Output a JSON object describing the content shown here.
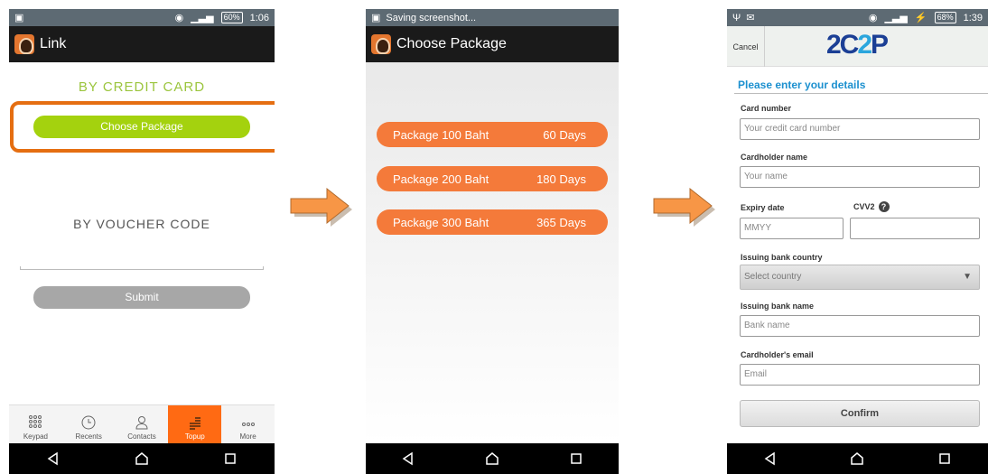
{
  "screen1": {
    "status_battery": "60%",
    "status_time": "1:06",
    "app_title": "Link",
    "credit_title": "BY CREDIT CARD",
    "choose_package": "Choose Package",
    "voucher_title": "BY VOUCHER CODE",
    "submit": "Submit",
    "tabs": [
      {
        "label": "Keypad",
        "icon": "keypad-icon"
      },
      {
        "label": "Recents",
        "icon": "clock-icon"
      },
      {
        "label": "Contacts",
        "icon": "contact-icon"
      },
      {
        "label": "Topup",
        "icon": "coins-icon"
      },
      {
        "label": "More",
        "icon": "more-icon"
      }
    ],
    "highlight_color": "#e56e11"
  },
  "screen2": {
    "status_text": "Saving screenshot...",
    "app_title": "Choose Package",
    "packages": [
      {
        "name": "Package 100 Baht",
        "days": "60 Days"
      },
      {
        "name": "Package 200 Baht",
        "days": "180 Days"
      },
      {
        "name": "Package 300 Baht",
        "days": "365 Days"
      }
    ],
    "accent_color": "#f47a3a"
  },
  "screen3": {
    "status_battery": "68%",
    "status_time": "1:39",
    "cancel": "Cancel",
    "brand_left": "2C",
    "brand_mid": "2",
    "brand_right": "P",
    "form_title": "Please enter your details",
    "card_number_label": "Card number",
    "card_number_placeholder": "Your credit card number",
    "holder_label": "Cardholder name",
    "holder_placeholder": "Your name",
    "expiry_label": "Expiry date",
    "expiry_placeholder": "MMYY",
    "cvv_label": "CVV2",
    "country_label": "Issuing bank country",
    "country_value": "Select country",
    "bank_label": "Issuing bank name",
    "bank_placeholder": "Bank name",
    "email_label": "Cardholder's email",
    "email_placeholder": "Email",
    "confirm": "Confirm"
  }
}
